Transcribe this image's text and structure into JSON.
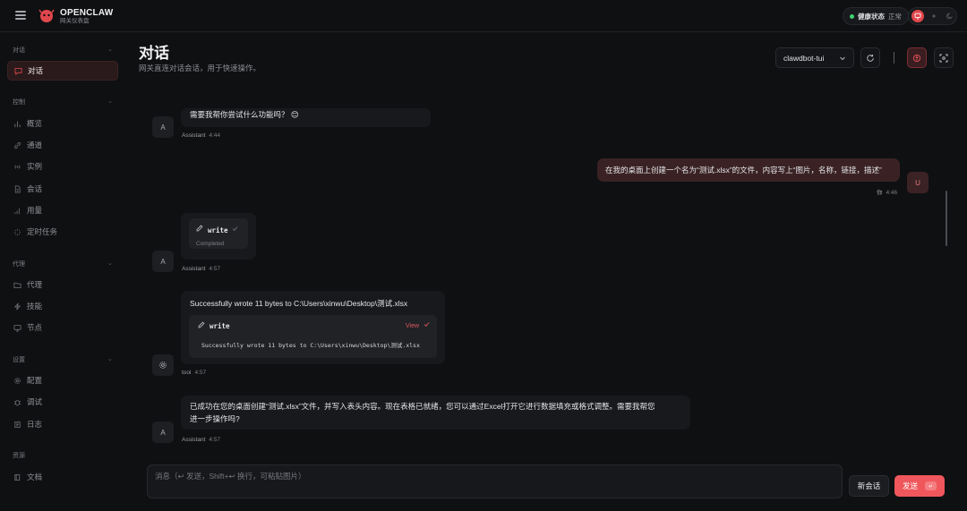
{
  "topbar": {
    "brand_name": "OPENCLAW",
    "brand_sub": "网关仪表盘",
    "health_label": "健康状态",
    "health_value": "正常"
  },
  "sidebar": {
    "groups": [
      {
        "title": "对话",
        "items": [
          {
            "label": "对话",
            "icon": "chat-icon",
            "active": true
          }
        ]
      },
      {
        "title": "控制",
        "items": [
          {
            "label": "概览",
            "icon": "bar-chart-icon"
          },
          {
            "label": "通道",
            "icon": "link-icon"
          },
          {
            "label": "实例",
            "icon": "broadcast-icon"
          },
          {
            "label": "会话",
            "icon": "document-icon"
          },
          {
            "label": "用量",
            "icon": "usage-icon"
          },
          {
            "label": "定时任务",
            "icon": "loader-icon"
          }
        ]
      },
      {
        "title": "代理",
        "items": [
          {
            "label": "代理",
            "icon": "folder-icon"
          },
          {
            "label": "技能",
            "icon": "zap-icon"
          },
          {
            "label": "节点",
            "icon": "monitor-icon"
          }
        ]
      },
      {
        "title": "设置",
        "items": [
          {
            "label": "配置",
            "icon": "gear-icon"
          },
          {
            "label": "调试",
            "icon": "bug-icon"
          },
          {
            "label": "日志",
            "icon": "log-icon"
          }
        ]
      },
      {
        "title": "资源",
        "items": [
          {
            "label": "文档",
            "icon": "book-icon"
          }
        ]
      }
    ]
  },
  "header": {
    "title": "对话",
    "subtitle": "网关直连对话会话，用于快速操作。",
    "session": "clawdbot-tui"
  },
  "messages": [
    {
      "role": "assistant",
      "avatar": "A",
      "text": "需要我帮你尝试什么功能吗？ 😊",
      "sender": "Assistant",
      "time": "4:44"
    },
    {
      "role": "user",
      "avatar": "U",
      "text": "在我的桌面上创建一个名为“测试.xlsx”的文件，内容写上“图片，名称，链接，描述”",
      "sender": "你",
      "time": "4:46"
    },
    {
      "role": "assistant",
      "avatar": "A",
      "tool_name": "write",
      "tool_status": "Completed",
      "sender": "Assistant",
      "time": "4:57"
    },
    {
      "role": "tool",
      "avatar_icon": "gear-icon",
      "text": "Successfully wrote 11 bytes to C:\\Users\\xinwu\\Desktop\\测试.xlsx",
      "tool_name": "write",
      "view_label": "View",
      "tool_output": "Successfully wrote 11 bytes to C:\\Users\\xinwu\\Desktop\\测试.xlsx",
      "sender": "tool",
      "time": "4:57"
    },
    {
      "role": "assistant",
      "avatar": "A",
      "text_line1": "已成功在您的桌面创建“测试.xlsx”文件，并写入表头内容。现在表格已就绪，您可以通过Excel打开它进行数据填充或格式调整。需要我帮您",
      "text_line2": "进一步操作吗?",
      "sender": "Assistant",
      "time": "4:57"
    }
  ],
  "composer": {
    "placeholder": "消息（↩ 发送，Shift+↩ 换行，可粘贴图片）",
    "new_session": "新会话",
    "send": "发送",
    "send_kbd": "↵"
  },
  "colors": {
    "accent": "#f0575c",
    "health": "#3ecf6f"
  }
}
